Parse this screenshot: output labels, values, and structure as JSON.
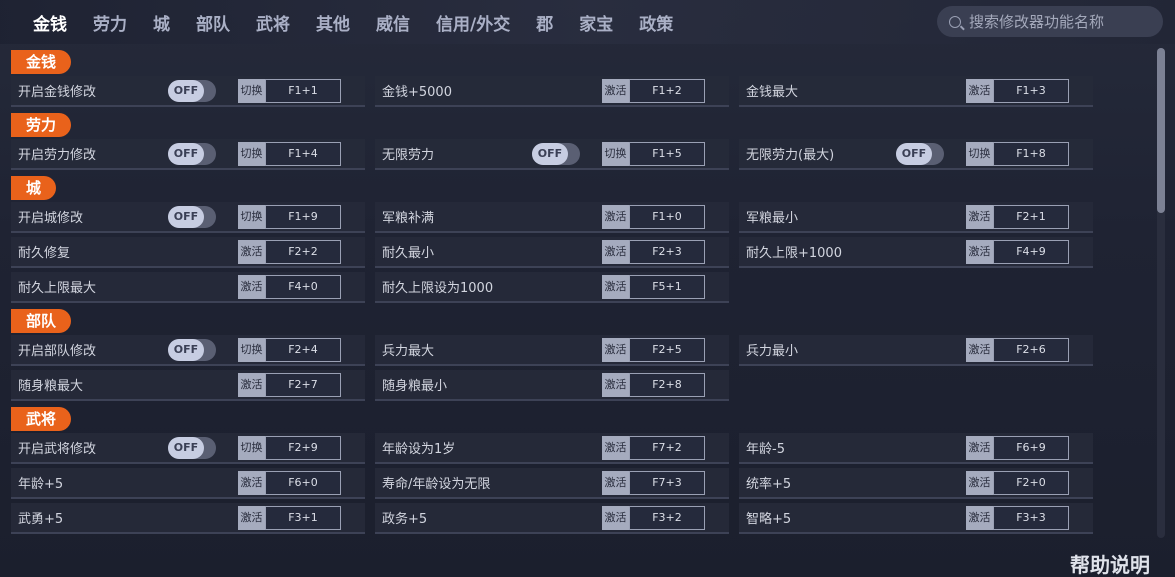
{
  "nav": [
    "金钱",
    "劳力",
    "城",
    "部队",
    "武将",
    "其他",
    "威信",
    "信用/外交",
    "郡",
    "家宝",
    "政策"
  ],
  "search": {
    "placeholder": "搜索修改器功能名称"
  },
  "help_label": "帮助说明",
  "toggle_off": "OFF",
  "sections": [
    {
      "title": "金钱",
      "rows": [
        [
          {
            "label": "开启金钱修改",
            "toggle": true,
            "action": "切换",
            "key": "F1+1"
          },
          {
            "label": "金钱+5000",
            "toggle": false,
            "action": "激活",
            "key": "F1+2"
          },
          {
            "label": "金钱最大",
            "toggle": false,
            "action": "激活",
            "key": "F1+3"
          }
        ]
      ]
    },
    {
      "title": "劳力",
      "rows": [
        [
          {
            "label": "开启劳力修改",
            "toggle": true,
            "action": "切换",
            "key": "F1+4"
          },
          {
            "label": "无限劳力",
            "toggle": true,
            "action": "切换",
            "key": "F1+5"
          },
          {
            "label": "无限劳力(最大)",
            "toggle": true,
            "action": "切换",
            "key": "F1+8"
          }
        ]
      ]
    },
    {
      "title": "城",
      "rows": [
        [
          {
            "label": "开启城修改",
            "toggle": true,
            "action": "切换",
            "key": "F1+9"
          },
          {
            "label": "军粮补满",
            "toggle": false,
            "action": "激活",
            "key": "F1+0"
          },
          {
            "label": "军粮最小",
            "toggle": false,
            "action": "激活",
            "key": "F2+1"
          }
        ],
        [
          {
            "label": "耐久修复",
            "toggle": false,
            "action": "激活",
            "key": "F2+2"
          },
          {
            "label": "耐久最小",
            "toggle": false,
            "action": "激活",
            "key": "F2+3"
          },
          {
            "label": "耐久上限+1000",
            "toggle": false,
            "action": "激活",
            "key": "F4+9"
          }
        ],
        [
          {
            "label": "耐久上限最大",
            "toggle": false,
            "action": "激活",
            "key": "F4+0"
          },
          {
            "label": "耐久上限设为1000",
            "toggle": false,
            "action": "激活",
            "key": "F5+1"
          }
        ]
      ]
    },
    {
      "title": "部队",
      "rows": [
        [
          {
            "label": "开启部队修改",
            "toggle": true,
            "action": "切换",
            "key": "F2+4"
          },
          {
            "label": "兵力最大",
            "toggle": false,
            "action": "激活",
            "key": "F2+5"
          },
          {
            "label": "兵力最小",
            "toggle": false,
            "action": "激活",
            "key": "F2+6"
          }
        ],
        [
          {
            "label": "随身粮最大",
            "toggle": false,
            "action": "激活",
            "key": "F2+7"
          },
          {
            "label": "随身粮最小",
            "toggle": false,
            "action": "激活",
            "key": "F2+8"
          }
        ]
      ]
    },
    {
      "title": "武将",
      "rows": [
        [
          {
            "label": "开启武将修改",
            "toggle": true,
            "action": "切换",
            "key": "F2+9"
          },
          {
            "label": "年龄设为1岁",
            "toggle": false,
            "action": "激活",
            "key": "F7+2"
          },
          {
            "label": "年龄-5",
            "toggle": false,
            "action": "激活",
            "key": "F6+9"
          }
        ],
        [
          {
            "label": "年龄+5",
            "toggle": false,
            "action": "激活",
            "key": "F6+0"
          },
          {
            "label": "寿命/年龄设为无限",
            "toggle": false,
            "action": "激活",
            "key": "F7+3"
          },
          {
            "label": "统率+5",
            "toggle": false,
            "action": "激活",
            "key": "F2+0"
          }
        ],
        [
          {
            "label": "武勇+5",
            "toggle": false,
            "action": "激活",
            "key": "F3+1"
          },
          {
            "label": "政务+5",
            "toggle": false,
            "action": "激活",
            "key": "F3+2"
          },
          {
            "label": "智略+5",
            "toggle": false,
            "action": "激活",
            "key": "F3+3"
          }
        ]
      ]
    }
  ]
}
